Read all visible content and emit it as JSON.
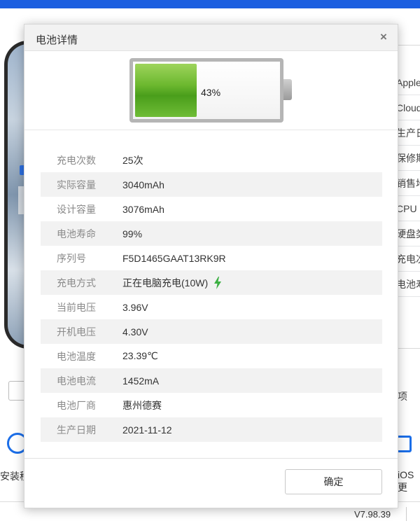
{
  "background": {
    "right_labels": [
      "Apple",
      "Cloud",
      "生产日",
      "保修期",
      "销售地",
      "CPU",
      "硬盘类",
      "充电次",
      "电池寿"
    ],
    "right_mid_text": "项",
    "left_action_label": "安装移",
    "right_action_label": "iOS更",
    "version": "V7.98.39"
  },
  "dialog": {
    "title": "电池详情",
    "close_glyph": "×",
    "battery": {
      "percent_text": "43%",
      "level": 0.43,
      "fill_color": "#6cb82f"
    },
    "rows": [
      {
        "key": "充电次数",
        "value": "25次"
      },
      {
        "key": "实际容量",
        "value": "3040mAh"
      },
      {
        "key": "设计容量",
        "value": "3076mAh"
      },
      {
        "key": "电池寿命",
        "value": "99%"
      },
      {
        "key": "序列号",
        "value": "F5D1465GAAT13RK9R"
      },
      {
        "key": "充电方式",
        "value": "正在电脑充电(10W)",
        "icon": "lightning-bolt-icon"
      },
      {
        "key": "当前电压",
        "value": "3.96V"
      },
      {
        "key": "开机电压",
        "value": "4.30V"
      },
      {
        "key": "电池温度",
        "value": "23.39℃"
      },
      {
        "key": "电池电流",
        "value": "1452mA"
      },
      {
        "key": "电池厂商",
        "value": "惠州德赛"
      },
      {
        "key": "生产日期",
        "value": "2021-11-12"
      }
    ],
    "ok_label": "确定"
  },
  "colors": {
    "accent": "#1c5fe0",
    "bolt": "#3cb043",
    "battery_green": "#6cb82f"
  }
}
